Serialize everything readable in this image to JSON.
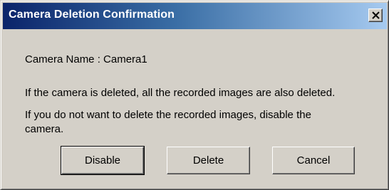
{
  "window": {
    "title": "Camera Deletion Confirmation",
    "close_icon": "close-x-icon"
  },
  "content": {
    "camera_name_line": "Camera Name :  Camera1",
    "message_line1": "If the camera is deleted, all the recorded images are also deleted.",
    "message_line2": "If you do not want to delete the recorded images, disable the",
    "message_line3": "camera."
  },
  "buttons": {
    "disable": "Disable",
    "delete": "Delete",
    "cancel": "Cancel"
  },
  "colors": {
    "titlebar_start": "#0a246a",
    "titlebar_end": "#a6caf0",
    "dialog_face": "#d4d0c8"
  }
}
